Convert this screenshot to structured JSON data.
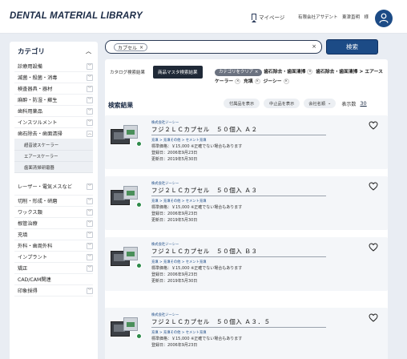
{
  "header": {
    "logo": "DENTAL MATERIAL LIBRARY",
    "mypage_label": "マイページ",
    "user_text": "有限会社アサデント　東津直明　様"
  },
  "sidebar": {
    "title": "カテゴリ",
    "categories": [
      {
        "label": "診療用設備"
      },
      {
        "label": "滅菌・殺菌・消毒"
      },
      {
        "label": "検査器具・器材"
      },
      {
        "label": "麻酔・防湿・蘇生"
      },
      {
        "label": "歯科用薬品"
      },
      {
        "label": "インスツルメント"
      },
      {
        "label": "歯石除去・歯面清掃"
      }
    ],
    "subcategories": [
      "超音波スケーラー",
      "エアースケーラー",
      "歯面清掃研磨器"
    ],
    "categories2": [
      {
        "label": "レーザー・電気メスなど"
      },
      {
        "label": "切削・形成・研磨"
      },
      {
        "label": "ワックス類"
      },
      {
        "label": "根管治療"
      },
      {
        "label": "充填"
      },
      {
        "label": "外科・歯周外科"
      },
      {
        "label": "インプラント"
      },
      {
        "label": "矯正"
      },
      {
        "label": "CAD/CAM関連"
      },
      {
        "label": "印象採得"
      }
    ]
  },
  "search": {
    "chip_label": "カプセル",
    "button_label": "検索"
  },
  "tabs": {
    "catalog": "カタログ検索結果",
    "master": "商品マスタ検索結果"
  },
  "filters": {
    "clear_label": "カテゴリをクリア",
    "f1": "歯石除去・歯面清掃",
    "f2": "歯石除去・歯面清掃 > エアースケーラー",
    "f3": "充填",
    "f4": "ジーシー"
  },
  "results": {
    "title": "検索結果",
    "show_accessories": "付属品を表示",
    "show_discontinued": "中止品を表示",
    "sort_label": "会社名順",
    "count_label": "表示数",
    "count_value": "30"
  },
  "products": [
    {
      "maker": "株式会社ジーシー",
      "name": "フジ２ＬＣカプセル　５０個入 Ａ２",
      "categories": "充填 > 充填その他 > セメント充填",
      "price": "標準価格：￥15,000 ※正確でない場合もあります",
      "registered": "登録日：2006年9月23日",
      "updated": "更新日：2019年5月30日"
    },
    {
      "maker": "株式会社ジーシー",
      "name": "フジ２ＬＣカプセル　５０個入 Ａ３",
      "categories": "充填 > 充填その他 > セメント充填",
      "price": "標準価格：￥15,000 ※正確でない場合もあります",
      "registered": "登録日：2006年9月23日",
      "updated": "更新日：2019年5月30日"
    },
    {
      "maker": "株式会社ジーシー",
      "name": "フジ２ＬＣカプセル　５０個入 Ｂ３",
      "categories": "充填 > 充填その他 > セメント充填",
      "price": "標準価格：￥15,000 ※正確でない場合もあります",
      "registered": "登録日：2006年9月23日",
      "updated": "更新日：2019年5月30日"
    },
    {
      "maker": "株式会社ジーシー",
      "name": "フジ２ＬＣカプセル　５０個入 Ａ３．５",
      "categories": "充填 > 充填その他 > セメント充填",
      "price": "標準価格：￥15,000 ※正確でない場合もあります",
      "registered": "登録日：2006年9月23日",
      "updated": ""
    }
  ],
  "colors": {
    "brand": "#1c4b86",
    "background": "#e9edf3",
    "card": "#f4f6f9",
    "active_tab": "#1f2937"
  }
}
